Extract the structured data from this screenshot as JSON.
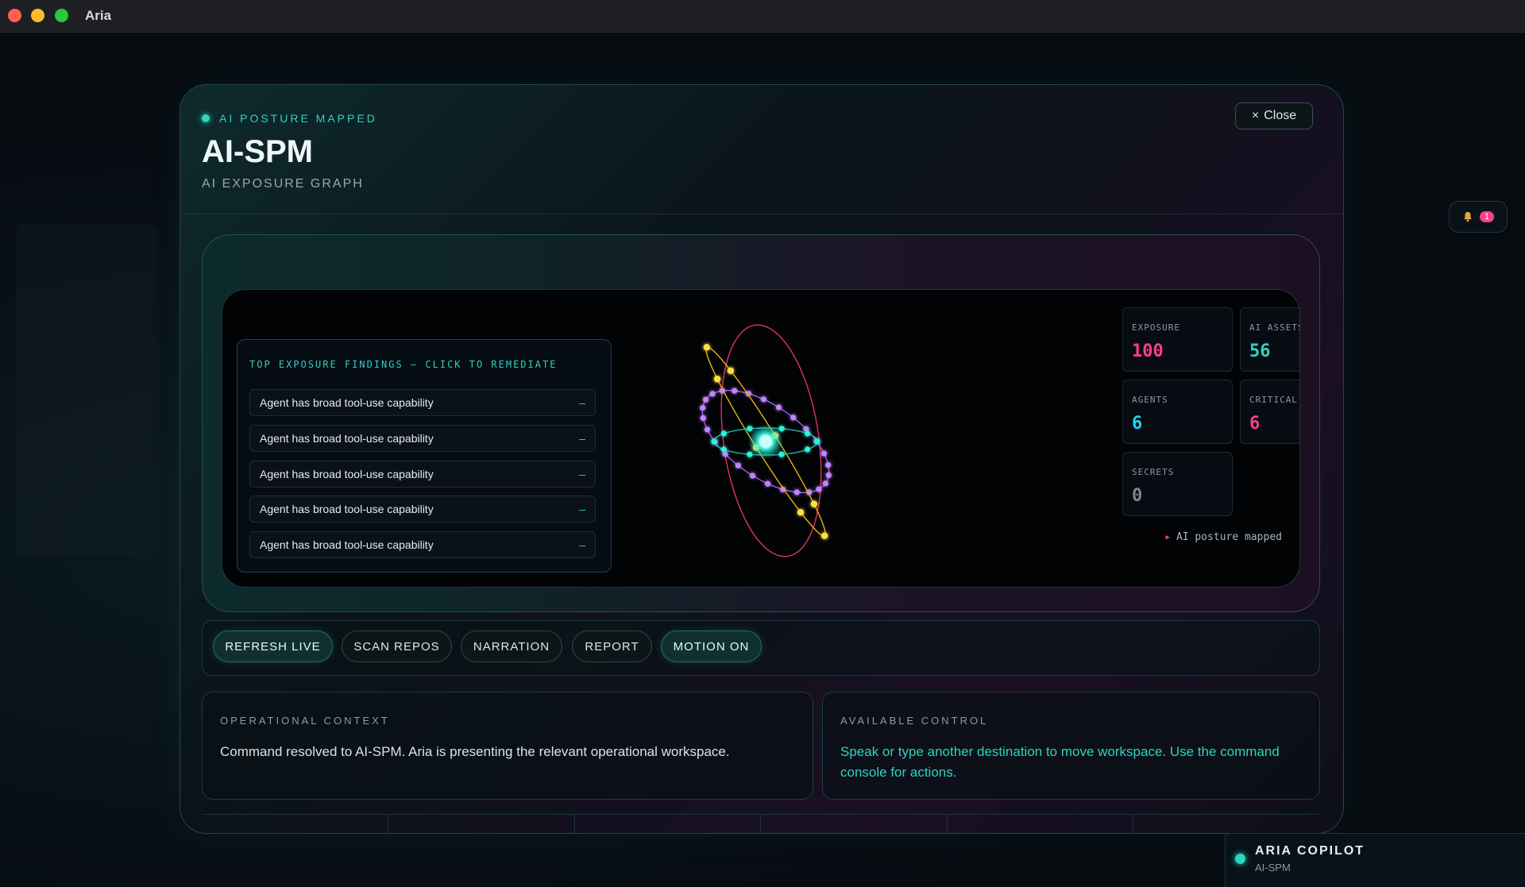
{
  "window": {
    "title": "Aria"
  },
  "notifications": {
    "count": "1"
  },
  "modal": {
    "eyebrow": "AI POSTURE MAPPED",
    "title": "AI-SPM",
    "subtitle": "AI EXPOSURE GRAPH",
    "close_label": "Close",
    "close_icon": "×"
  },
  "findings": {
    "title": "TOP EXPOSURE FINDINGS — CLICK TO REMEDIATE",
    "items": [
      {
        "label": "Agent has broad tool-use capability",
        "marker": "–"
      },
      {
        "label": "Agent has broad tool-use capability",
        "marker": "–"
      },
      {
        "label": "Agent has broad tool-use capability",
        "marker": "–"
      },
      {
        "label": "Agent has broad tool-use capability",
        "marker": "–"
      },
      {
        "label": "Agent has broad tool-use capability",
        "marker": "–"
      }
    ]
  },
  "metrics": [
    {
      "label": "EXPOSURE",
      "value": "100",
      "color": "#ff3d8b"
    },
    {
      "label": "AI ASSETS",
      "value": "56",
      "color": "#2dd4bf"
    },
    {
      "label": "AGENTS",
      "value": "6",
      "color": "#22d3ee"
    },
    {
      "label": "CRITICAL",
      "value": "6",
      "color": "#ff3d8b"
    },
    {
      "label": "SECRETS",
      "value": "0",
      "color": "#7b8690"
    }
  ],
  "posture_status": "AI posture mapped",
  "actions": [
    {
      "label": "REFRESH LIVE",
      "active": true
    },
    {
      "label": "SCAN REPOS",
      "active": false
    },
    {
      "label": "NARRATION",
      "active": false
    },
    {
      "label": "REPORT",
      "active": false
    },
    {
      "label": "MOTION ON",
      "active": true
    }
  ],
  "context": {
    "title": "OPERATIONAL CONTEXT",
    "body": "Command resolved to AI-SPM. Aria is presenting the relevant operational workspace."
  },
  "control": {
    "title": "AVAILABLE CONTROL",
    "body": "Speak or type another destination to move workspace. Use the command console for actions."
  },
  "copilot": {
    "name": "ARIA COPILOT",
    "context": "AI-SPM"
  },
  "colors": {
    "accent": "#2dd4bf",
    "danger": "#ff3d8b",
    "purple": "#a855f7",
    "gold": "#facc15"
  }
}
